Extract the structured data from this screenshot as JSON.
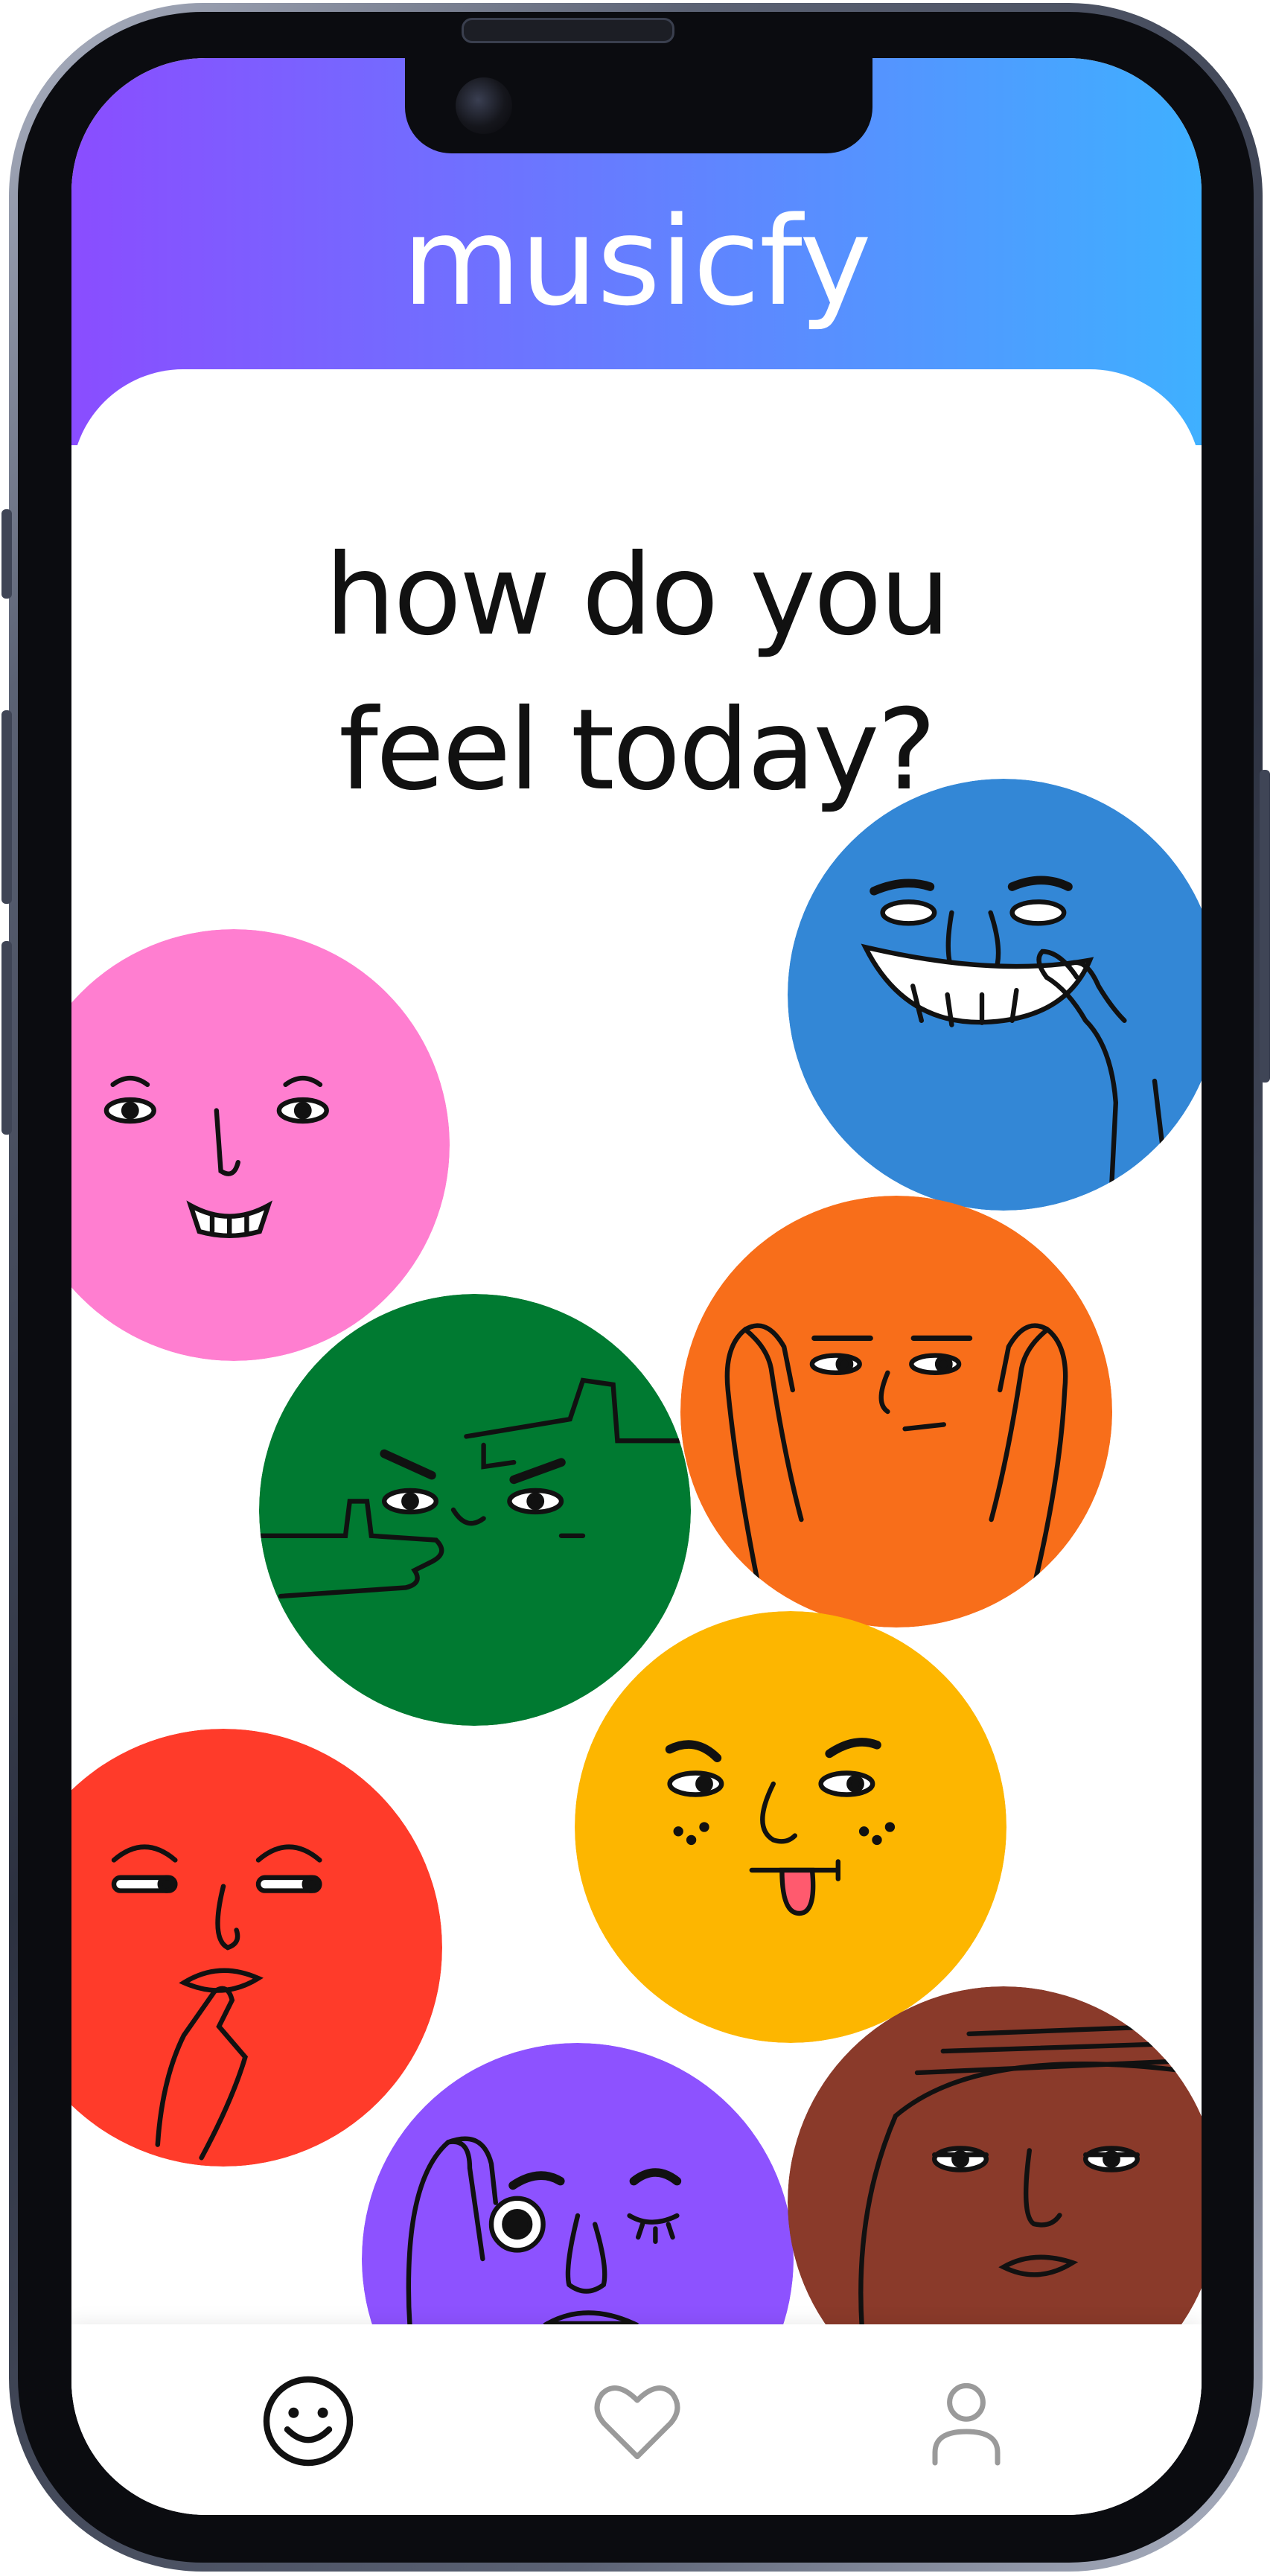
{
  "app": {
    "title": "musicfy"
  },
  "main": {
    "question_line1": "how do you",
    "question_line2": "feel today?"
  },
  "moods": [
    {
      "id": "laughing",
      "color": "#3387D6"
    },
    {
      "id": "smiling",
      "color": "#FF7ED0"
    },
    {
      "id": "thinking",
      "color": "#F86E1A"
    },
    {
      "id": "pointing",
      "color": "#007A31"
    },
    {
      "id": "cheeky",
      "color": "#FDB600"
    },
    {
      "id": "shushing",
      "color": "#FF3B2A"
    },
    {
      "id": "winking",
      "color": "#8D52FF"
    },
    {
      "id": "bored",
      "color": "#8A3A2A"
    }
  ],
  "nav": {
    "items": [
      {
        "icon": "smiley-icon",
        "active": true
      },
      {
        "icon": "heart-icon",
        "active": false
      },
      {
        "icon": "user-icon",
        "active": false
      }
    ],
    "active_color": "#111111",
    "inactive_color": "#9a9a9a"
  },
  "colors": {
    "header_gradient_start": "#8A4DFF",
    "header_gradient_end": "#3FB0FF"
  }
}
